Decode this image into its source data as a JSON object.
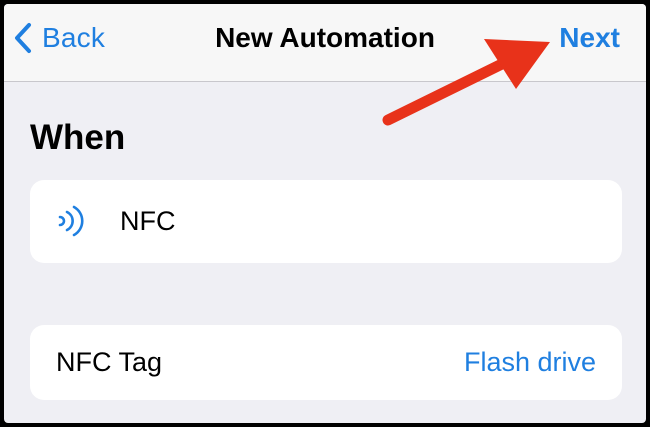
{
  "nav": {
    "back_label": "Back",
    "title": "New Automation",
    "next_label": "Next"
  },
  "section": {
    "heading": "When"
  },
  "trigger": {
    "icon": "nfc-icon",
    "label": "NFC"
  },
  "nfc_tag": {
    "label": "NFC Tag",
    "value": "Flash drive"
  },
  "colors": {
    "accent": "#1f7fe0",
    "annotation_arrow": "#e8321a",
    "background": "#efeff4",
    "card": "#ffffff",
    "nav_bar": "#f7f7f7"
  }
}
